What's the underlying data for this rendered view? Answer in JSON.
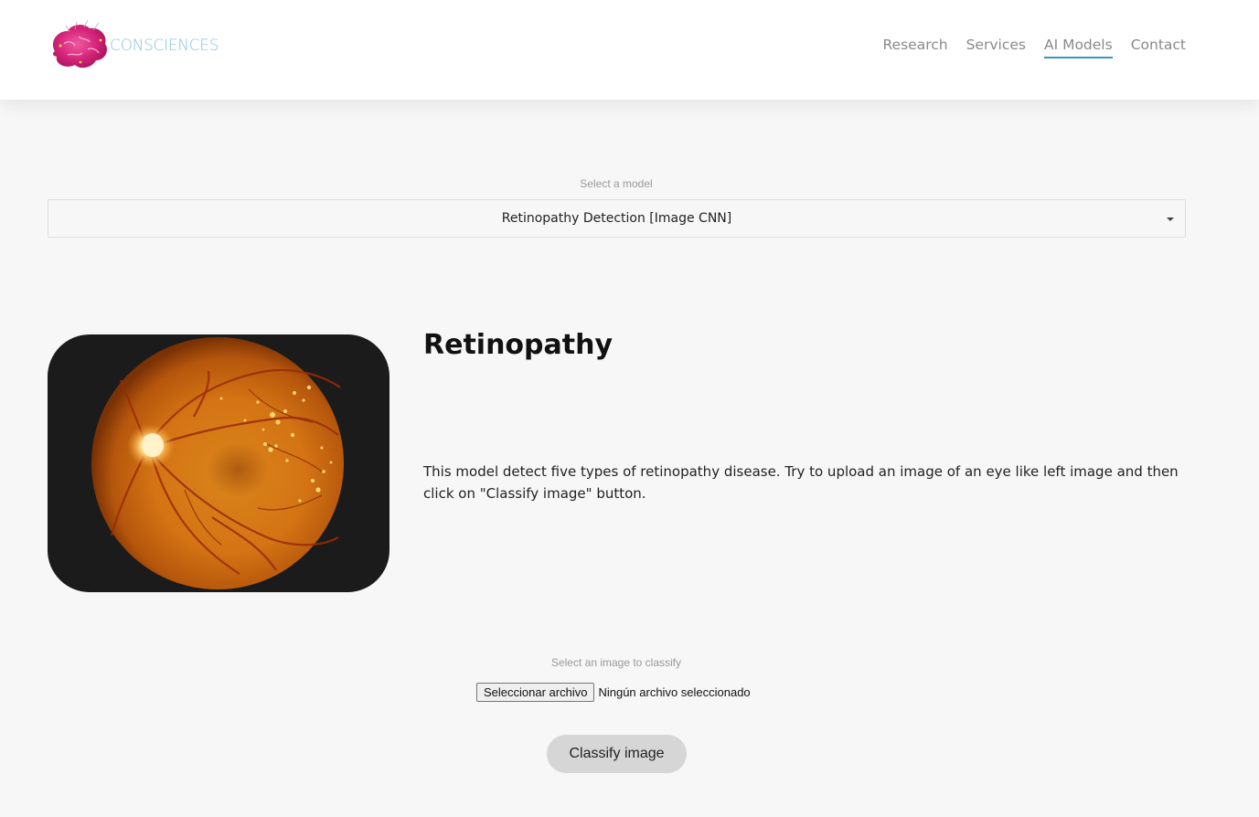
{
  "brand": {
    "name": "CONSCIENCES",
    "logo_icon": "brain-logo-icon",
    "text_color": "#8cc2dc",
    "mark_color": "#d4237a"
  },
  "nav": {
    "items": [
      {
        "label": "Research",
        "active": false
      },
      {
        "label": "Services",
        "active": false
      },
      {
        "label": "AI Models",
        "active": true
      },
      {
        "label": "Contact",
        "active": false
      }
    ],
    "accent": "#3a90c8"
  },
  "model_select": {
    "label": "Select a model",
    "value": "Retinopathy Detection [Image CNN]",
    "caret_icon": "caret-down-icon"
  },
  "model": {
    "title": "Retinopathy",
    "description": "This model detect five types of retinopathy disease. Try to upload an image of an eye like left image and then click on \"Classify image\" button.",
    "image_icon": "retina-fundus-image"
  },
  "upload": {
    "label": "Select an image to classify",
    "button_label": "Seleccionar archivo",
    "status": "Ningún archivo seleccionado"
  },
  "classify": {
    "label": "Classify image"
  }
}
